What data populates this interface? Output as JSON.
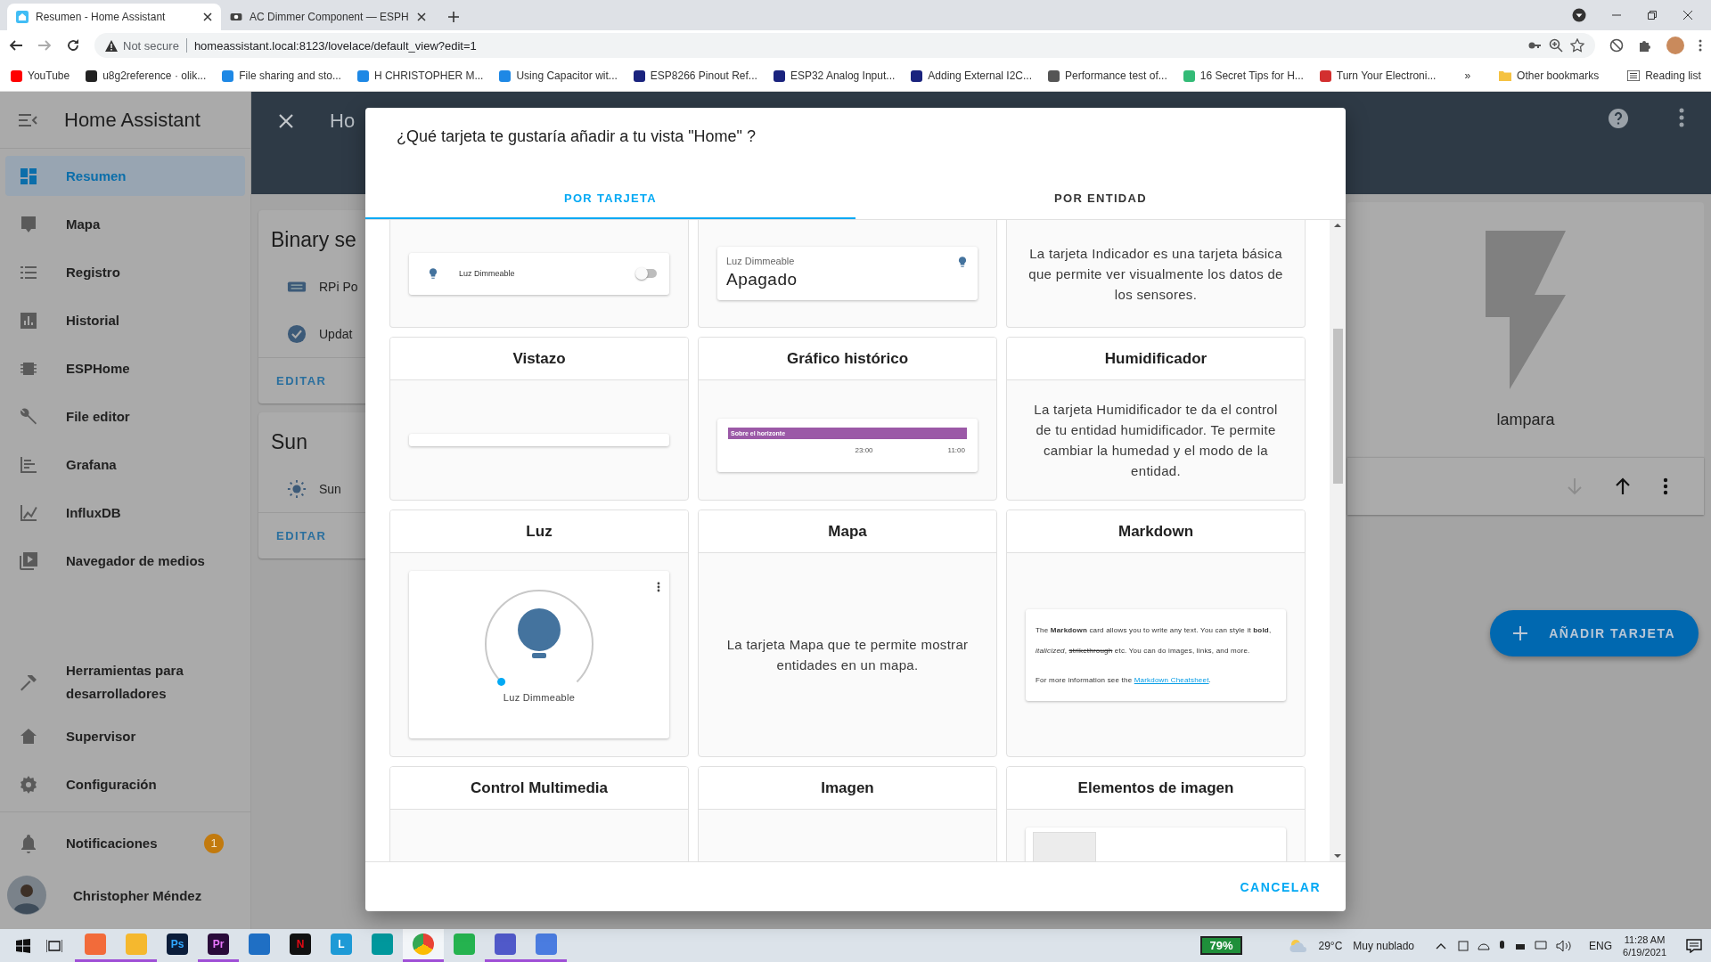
{
  "browser": {
    "tabs": [
      {
        "title": "Resumen - Home Assistant",
        "selected": true
      },
      {
        "title": "AC Dimmer Component — ESPH",
        "selected": false
      }
    ],
    "security": "Not secure",
    "url": "homeassistant.local:8123/lovelace/default_view?edit=1",
    "bookmarks": [
      "YouTube",
      "u8g2reference · olik...",
      "File sharing and sto...",
      "H CHRISTOPHER M...",
      "Using Capacitor wit...",
      "ESP8266 Pinout Ref...",
      "ESP32 Analog Input...",
      "Adding External I2C...",
      "Performance test of...",
      "16 Secret Tips for H...",
      "Turn Your Electroni..."
    ],
    "more_bookmarks": "»",
    "other_bookmarks": "Other bookmarks",
    "reading_list": "Reading list"
  },
  "sidebar": {
    "title": "Home Assistant",
    "items": [
      {
        "label": "Resumen",
        "selected": true
      },
      {
        "label": "Mapa",
        "selected": false
      },
      {
        "label": "Registro",
        "selected": false
      },
      {
        "label": "Historial",
        "selected": false
      },
      {
        "label": "ESPHome",
        "selected": false
      },
      {
        "label": "File editor",
        "selected": false
      },
      {
        "label": "Grafana",
        "selected": false
      },
      {
        "label": "InfluxDB",
        "selected": false
      },
      {
        "label": "Navegador de medios",
        "selected": false
      }
    ],
    "tools": [
      {
        "label": "Herramientas para desarrolladores",
        "selected": false
      },
      {
        "label": "Supervisor",
        "selected": false
      },
      {
        "label": "Configuración",
        "selected": false
      }
    ],
    "notifications": {
      "label": "Notificaciones",
      "badge": "1"
    },
    "user": "Christopher Méndez"
  },
  "view": {
    "title": "Ho",
    "cards": [
      {
        "title": "Binary se",
        "entities": [
          "RPi Po",
          "Updat"
        ],
        "action": "EDITAR"
      },
      {
        "title": "Sun",
        "entities": [
          "Sun"
        ],
        "action": "EDITAR"
      }
    ],
    "entity_card": {
      "name": "lampara"
    },
    "add_button": "AÑADIR TARJETA"
  },
  "dialog": {
    "title": "¿Qué tarjeta te gustaría añadir a tu vista \"Home\" ?",
    "tabs": [
      {
        "label": "POR TARJETA",
        "selected": true
      },
      {
        "label": "POR ENTIDAD",
        "selected": false
      }
    ],
    "cards": [
      {
        "kind": "entity-row",
        "name": "Luz Dimmeable",
        "on": false
      },
      {
        "kind": "entity",
        "name": "Luz Dimmeable",
        "state": "Apagado"
      },
      {
        "kind": "description",
        "text": "La tarjeta Indicador es una tarjeta básica que permite ver visualmente los datos de los sensores."
      },
      {
        "kind": "glance",
        "title": "Vistazo"
      },
      {
        "kind": "history",
        "title": "Gráfico histórico",
        "bar_label": "Sobre el horizonte",
        "ticks": [
          "23:00",
          "11:00"
        ]
      },
      {
        "kind": "description",
        "title": "Humidificador",
        "text": "La tarjeta Humidificador te da el control de tu entidad humidificador. Te permite cambiar la humedad y el modo de la entidad."
      },
      {
        "kind": "light",
        "title": "Luz",
        "name": "Luz Dimmeable"
      },
      {
        "kind": "description",
        "title": "Mapa",
        "text": "La tarjeta Mapa que te permite mostrar entidades en un mapa."
      },
      {
        "kind": "markdown",
        "title": "Markdown",
        "text_before": "The **Markdown** card allows you to write any text. You can style it **bold**, *italicized*, ",
        "struck": "strikethrough",
        "text_after": " etc. You can do images, links, and more.",
        "info": "For more information see the ",
        "link": "Markdown Cheatsheet",
        "info_end": "."
      },
      {
        "kind": "empty",
        "title": "Control Multimedia"
      },
      {
        "kind": "empty",
        "title": "Imagen"
      },
      {
        "kind": "picture-elements",
        "title": "Elementos de imagen"
      }
    ],
    "cancel": "CANCELAR"
  },
  "taskbar": {
    "apps": [
      {
        "running": true,
        "selected": false
      },
      {
        "running": true,
        "selected": false
      },
      {
        "glyph": "Ps",
        "running": false,
        "selected": false
      },
      {
        "glyph": "Pr",
        "running": true,
        "selected": false
      },
      {
        "running": false,
        "selected": false
      },
      {
        "glyph": "N",
        "running": false,
        "selected": false
      },
      {
        "glyph": "L",
        "running": false,
        "selected": false
      },
      {
        "running": false,
        "selected": false
      },
      {
        "running": true,
        "selected": true
      },
      {
        "running": false,
        "selected": false
      },
      {
        "running": true,
        "selected": false
      },
      {
        "running": true,
        "selected": false
      }
    ],
    "battery": "79%",
    "temperature": "29°C",
    "weather": "Muy nublado",
    "language": "ENG",
    "time": "11:28 AM",
    "date": "6/19/2021"
  }
}
